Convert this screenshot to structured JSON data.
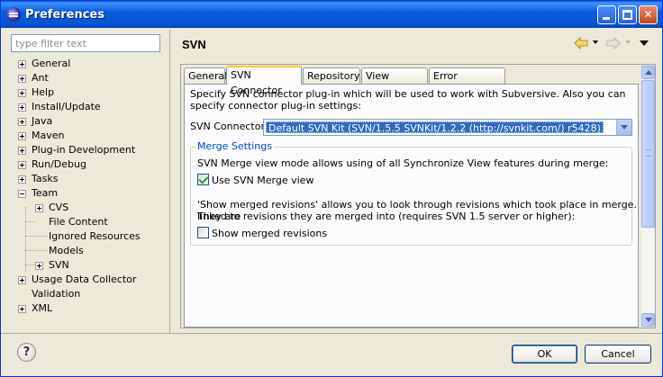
{
  "window": {
    "title": "Preferences"
  },
  "filter": {
    "placeholder": "type filter text"
  },
  "tree": [
    {
      "label": "General",
      "expander": "plus",
      "level": 0
    },
    {
      "label": "Ant",
      "expander": "plus",
      "level": 0
    },
    {
      "label": "Help",
      "expander": "plus",
      "level": 0
    },
    {
      "label": "Install/Update",
      "expander": "plus",
      "level": 0
    },
    {
      "label": "Java",
      "expander": "plus",
      "level": 0
    },
    {
      "label": "Maven",
      "expander": "plus",
      "level": 0
    },
    {
      "label": "Plug-in Development",
      "expander": "plus",
      "level": 0
    },
    {
      "label": "Run/Debug",
      "expander": "plus",
      "level": 0
    },
    {
      "label": "Tasks",
      "expander": "plus",
      "level": 0
    },
    {
      "label": "Team",
      "expander": "minus",
      "level": 0
    },
    {
      "label": "CVS",
      "expander": "plus",
      "level": 1
    },
    {
      "label": "File Content",
      "expander": "none",
      "level": 1
    },
    {
      "label": "Ignored Resources",
      "expander": "none",
      "level": 1
    },
    {
      "label": "Models",
      "expander": "none",
      "level": 1
    },
    {
      "label": "SVN",
      "expander": "plus",
      "level": 1,
      "selected": true
    },
    {
      "label": "Usage Data Collector",
      "expander": "plus",
      "level": 0
    },
    {
      "label": "Validation",
      "expander": "none",
      "level": 0
    },
    {
      "label": "XML",
      "expander": "plus",
      "level": 0
    }
  ],
  "page": {
    "title": "SVN"
  },
  "tabs": [
    "General",
    "SVN Connector",
    "Repository",
    "View Settings",
    "Error Reporting"
  ],
  "active_tab": "SVN Connector",
  "connector": {
    "description": "Specify SVN connector plug-in which will be used to work with Subversive. Also you can specify connector plug-in settings:",
    "label": "SVN Connector:",
    "value": "Default SVN Kit (SVN/1.5.5 SVNKit/1.2.2 (http://svnkit.com/) r5428)"
  },
  "merge": {
    "group_title": "Merge Settings",
    "mode_text": "SVN Merge view mode allows using of all Synchronize View features during merge:",
    "use_merge_view_label": "Use SVN Merge view",
    "use_merge_view_checked": true,
    "revisions_text_1": "'Show merged revisions' allows you to look through revisions which took place in merge. They are",
    "revisions_text_2": "linked to revisions they are merged into (requires SVN 1.5 server or higher):",
    "show_revisions_label": "Show merged revisions",
    "show_revisions_checked": false
  },
  "buttons": {
    "help": "?",
    "ok": "OK",
    "cancel": "Cancel"
  },
  "colors": {
    "title_bar": "#0454d4",
    "selection": "#316ac5",
    "group_title": "#0046d5",
    "active_tab_accent": "#ffc83c"
  }
}
